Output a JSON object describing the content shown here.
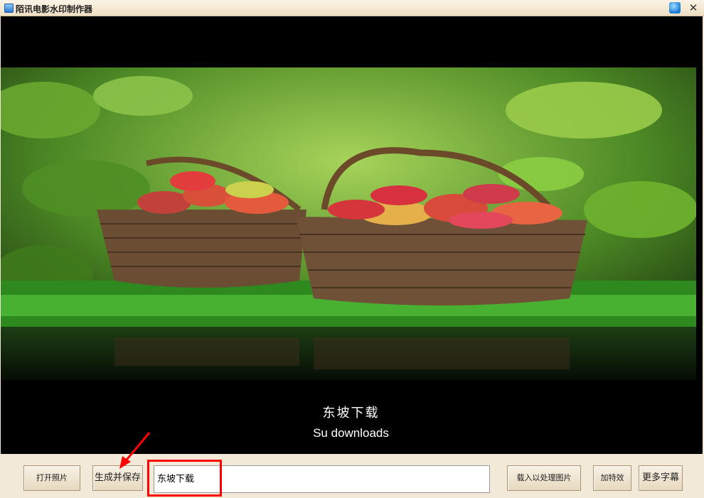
{
  "window": {
    "title": "陌讯电影水印制作器",
    "close_glyph": "✕"
  },
  "preview": {
    "caption_cn": "东坡下载",
    "caption_en": "Su downloads"
  },
  "toolbar": {
    "open_photo_label": "打开照片",
    "generate_save_label": "生成并保存",
    "text_input_value": "东坡下载",
    "load_process_label": "载入以处理图片",
    "add_effects_label": "加特效",
    "more_subtitles_label": "更多字幕"
  },
  "colors": {
    "annotation_red": "#ff0000",
    "window_background": "#f2e9d8"
  }
}
